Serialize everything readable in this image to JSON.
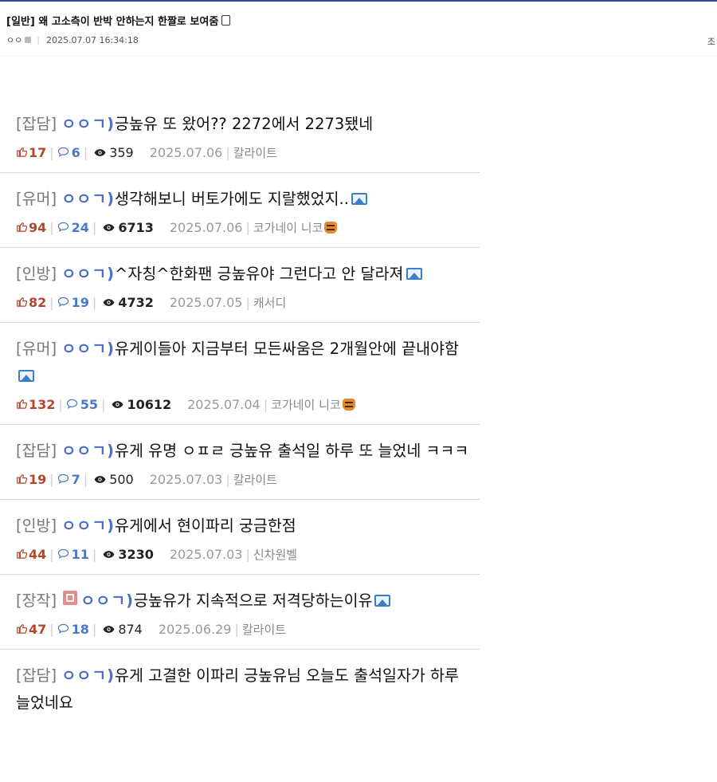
{
  "post": {
    "title": "[일반] 왜 고소측이 반박 안하는지 한짤로 보여줌",
    "author": "ㅇㅇ",
    "datetime": "2025.07.07 16:34:18",
    "right_text": "조"
  },
  "items": [
    {
      "category": "[잡담]",
      "nick": "ㅇㅇㄱ)",
      "title": "긍높유 또 왔어?? 2272에서 2273됐네",
      "likes": "17",
      "comments": "6",
      "views": "359",
      "date": "2025.07.06",
      "author": "칼라이트",
      "has_image": false,
      "views_bold": false,
      "badge": false,
      "tiger": false
    },
    {
      "category": "[유머]",
      "nick": "ㅇㅇㄱ)",
      "title": "생각해보니 버토가에도 지랄했었지..",
      "likes": "94",
      "comments": "24",
      "views": "6713",
      "date": "2025.07.06",
      "author": "코가네이 니코",
      "has_image": true,
      "views_bold": true,
      "badge": false,
      "tiger": true
    },
    {
      "category": "[인방]",
      "nick": "ㅇㅇㄱ)",
      "title": "^자칭^한화팬 긍높유야 그런다고 안 달라져",
      "likes": "82",
      "comments": "19",
      "views": "4732",
      "date": "2025.07.05",
      "author": "캐서디",
      "has_image": true,
      "views_bold": true,
      "badge": false,
      "tiger": false
    },
    {
      "category": "[유머]",
      "nick": "ㅇㅇㄱ)",
      "title": "유게이들아 지금부터 모든싸움은 2개월안에 끝내야함",
      "likes": "132",
      "comments": "55",
      "views": "10612",
      "date": "2025.07.04",
      "author": "코가네이 니코",
      "has_image": true,
      "views_bold": true,
      "badge": false,
      "tiger": true
    },
    {
      "category": "[잡담]",
      "nick": "ㅇㅇㄱ)",
      "title": "유게 유명 ㅇㅍㄹ 긍높유 출석일 하루 또 늘었네 ㅋㅋㅋ",
      "likes": "19",
      "comments": "7",
      "views": "500",
      "date": "2025.07.03",
      "author": "칼라이트",
      "has_image": false,
      "views_bold": false,
      "badge": false,
      "tiger": false
    },
    {
      "category": "[인방]",
      "nick": "ㅇㅇㄱ)",
      "title": "유게에서 현이파리 궁금한점",
      "likes": "44",
      "comments": "11",
      "views": "3230",
      "date": "2025.07.03",
      "author": "신차원벨",
      "has_image": false,
      "views_bold": true,
      "badge": false,
      "tiger": false
    },
    {
      "category": "[장작]",
      "nick": "ㅇㅇㄱ)",
      "title": "긍높유가 지속적으로 저격당하는이유",
      "likes": "47",
      "comments": "18",
      "views": "874",
      "date": "2025.06.29",
      "author": "칼라이트",
      "has_image": true,
      "views_bold": false,
      "badge": true,
      "tiger": false
    },
    {
      "category": "[잡담]",
      "nick": "ㅇㅇㄱ)",
      "title": "유게 고결한 이파리 긍높유님 오늘도 출석일자가 하루 늘었네요",
      "likes": "",
      "comments": "",
      "views": "",
      "date": "",
      "author": "",
      "has_image": false,
      "views_bold": false,
      "badge": false,
      "tiger": false
    }
  ],
  "colors": {
    "like": "#b5452b",
    "comment": "#4a78c9",
    "nick": "#4a6fc4",
    "category": "#777777"
  },
  "icons": {
    "like": "thumbs-up-icon",
    "comment": "comment-bubble-icon",
    "view": "eye-icon",
    "image": "image-icon"
  }
}
